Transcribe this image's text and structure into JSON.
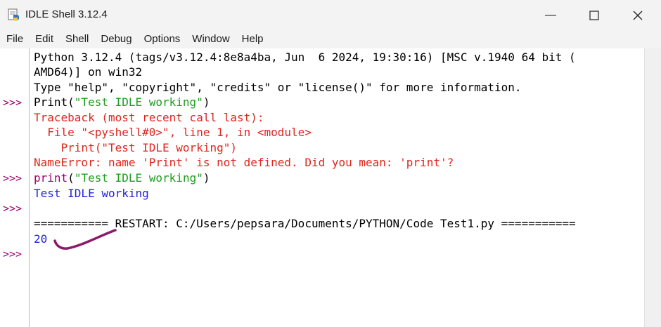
{
  "window": {
    "title": "IDLE Shell 3.12.4",
    "minimize_glyph": "—",
    "maximize_glyph": "☐",
    "close_glyph": "✕"
  },
  "menu": [
    "File",
    "Edit",
    "Shell",
    "Debug",
    "Options",
    "Window",
    "Help"
  ],
  "colors": {
    "prompt": "#a0006a",
    "string": "#1f9d1f",
    "error": "#e0251d",
    "output": "#2222dd",
    "annotation": "#8b1a6b"
  },
  "gutter": {
    "prompts": [
      ">>>",
      ">>>",
      ">>>",
      ">>>"
    ]
  },
  "shell": {
    "banner_line1": "Python 3.12.4 (tags/v3.12.4:8e8a4ba, Jun  6 2024, 19:30:16) [MSC v.1940 64 bit (",
    "banner_line2": "AMD64)] on win32",
    "banner_line3": "Type \"help\", \"copyright\", \"credits\" or \"license()\" for more information.",
    "cmd1_func": "Print(",
    "cmd1_str": "\"Test IDLE working\"",
    "cmd1_close": ")",
    "tb_header": "Traceback (most recent call last):",
    "tb_file": "  File \"<pyshell#0>\", line 1, in <module>",
    "tb_code": "    Print(\"Test IDLE working\")",
    "tb_error": "NameError: name 'Print' is not defined. Did you mean: 'print'?",
    "cmd2_func": "print",
    "cmd2_open": "(",
    "cmd2_str": "\"Test IDLE working\"",
    "cmd2_close": ")",
    "output1": "Test IDLE working",
    "restart": "=========== RESTART: C:/Users/pepsara/Documents/PYTHON/Code Test1.py ===========",
    "output2": "20"
  }
}
